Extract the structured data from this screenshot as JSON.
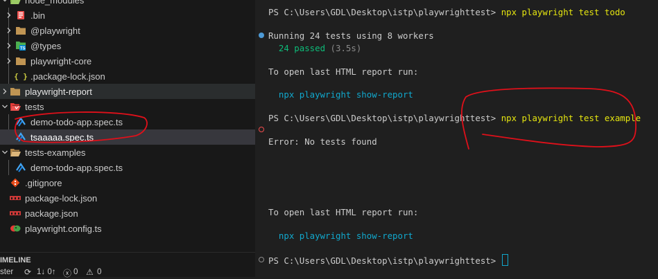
{
  "explorer": {
    "rows": [
      {
        "label": "node_modules",
        "icon": "folder-open-icon",
        "type": "folder-open"
      },
      {
        "label": ".bin",
        "icon": "bin-folder-icon",
        "type": "folder"
      },
      {
        "label": "@playwright",
        "icon": "folder-icon",
        "type": "folder"
      },
      {
        "label": "@types",
        "icon": "ts-folder-icon",
        "type": "folder"
      },
      {
        "label": "playwright-core",
        "icon": "folder-icon",
        "type": "folder"
      },
      {
        "label": ".package-lock.json",
        "icon": "json-icon",
        "type": "file"
      },
      {
        "label": "playwright-report",
        "icon": "folder-icon",
        "type": "folder"
      },
      {
        "label": "tests",
        "icon": "test-folder-icon",
        "type": "folder-open"
      },
      {
        "label": "demo-todo-app.spec.ts",
        "icon": "test-file-icon",
        "type": "file"
      },
      {
        "label": "tsaaaaa.spec.ts",
        "icon": "test-file-icon",
        "type": "file"
      },
      {
        "label": "tests-examples",
        "icon": "folder-open-icon",
        "type": "folder-open"
      },
      {
        "label": "demo-todo-app.spec.ts",
        "icon": "test-file-icon",
        "type": "file"
      },
      {
        "label": ".gitignore",
        "icon": "git-icon",
        "type": "file"
      },
      {
        "label": "package-lock.json",
        "icon": "npm-icon",
        "type": "file"
      },
      {
        "label": "package.json",
        "icon": "npm-icon",
        "type": "file"
      },
      {
        "label": "playwright.config.ts",
        "icon": "playwright-icon",
        "type": "file"
      }
    ]
  },
  "timeline": {
    "label": "IMELINE"
  },
  "statusbar": {
    "branch": "ster",
    "sync": "1↓ 0↑",
    "errors": "0",
    "warnings": "0"
  },
  "terminal": {
    "prompt1": "PS C:\\Users\\GDL\\Desktop\\istp\\playwrighttest> ",
    "command1": "npx playwright test todo",
    "running": "Running 24 tests using 8 workers",
    "passed": "24 passed",
    "duration": " (3.5s)",
    "report_hint1": "To open last HTML report run:",
    "report_cmd1": "npx playwright show-report",
    "prompt2": "PS C:\\Users\\GDL\\Desktop\\istp\\playwrighttest> ",
    "command2": "npx playwright test example",
    "error": "Error: No tests found",
    "report_hint2": "To open last HTML report run:",
    "report_cmd2": "npx playwright show-report",
    "prompt3": "PS C:\\Users\\GDL\\Desktop\\istp\\playwrighttest> "
  },
  "colors": {
    "annotation": "#e0101a",
    "command": "#e5e510",
    "cyan": "#11a8cd",
    "green": "#0dbc79"
  }
}
